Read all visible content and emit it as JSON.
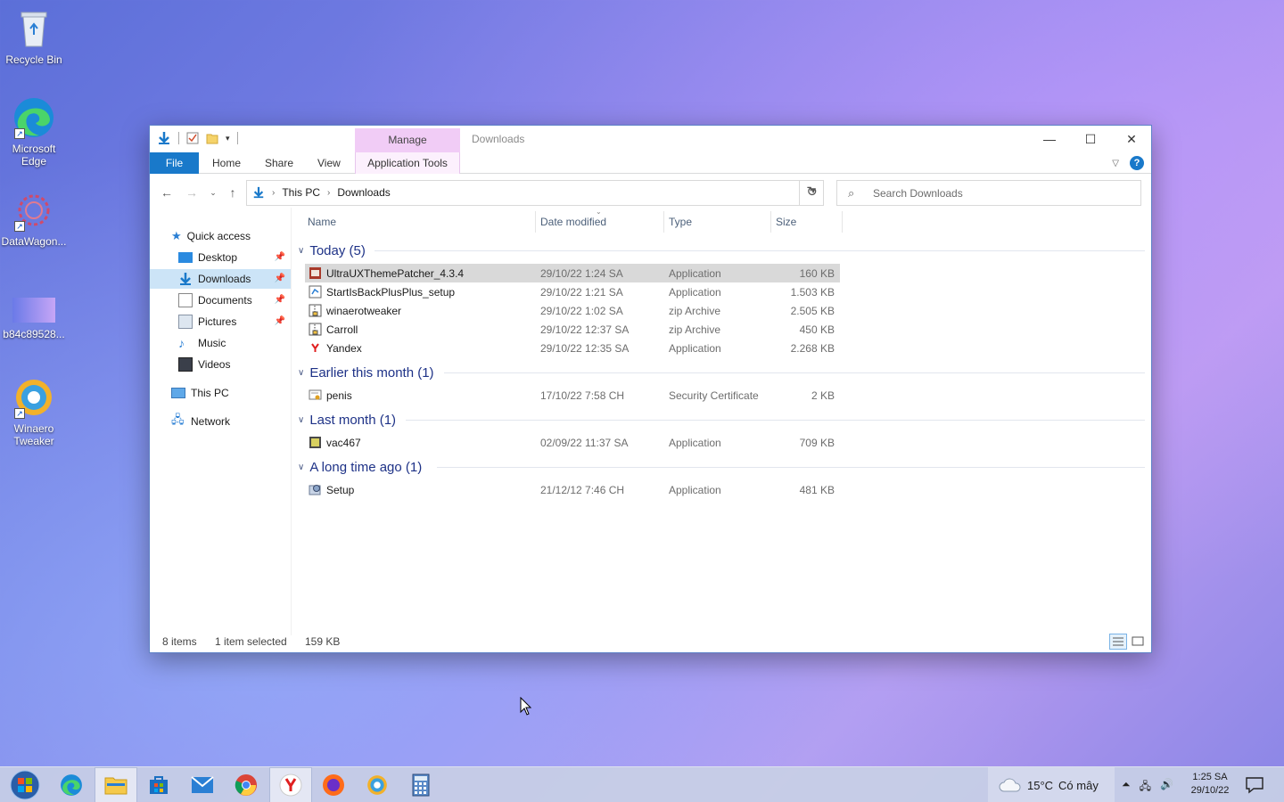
{
  "desktop": {
    "icons": [
      {
        "label": "Recycle Bin"
      },
      {
        "label": "Microsoft Edge"
      },
      {
        "label": "DataWagon..."
      },
      {
        "label": "b84c89528..."
      },
      {
        "label": "Winaero Tweaker"
      }
    ]
  },
  "window": {
    "title": "Downloads",
    "manage_tab": "Manage",
    "ribbon_tabs": [
      "File",
      "Home",
      "Share",
      "View",
      "Application Tools"
    ],
    "address": {
      "crumbs": [
        "This PC",
        "Downloads"
      ]
    },
    "search_placeholder": "Search Downloads",
    "nav": {
      "quick_access": "Quick access",
      "items": [
        "Desktop",
        "Downloads",
        "Documents",
        "Pictures",
        "Music",
        "Videos"
      ],
      "this_pc": "This PC",
      "network": "Network"
    },
    "columns": [
      "Name",
      "Date modified",
      "Type",
      "Size"
    ],
    "groups": [
      {
        "label": "Today (5)",
        "files": [
          {
            "name": "UltraUXThemePatcher_4.3.4",
            "date": "29/10/22 1:24 SA",
            "type": "Application",
            "size": "160 KB",
            "selected": true
          },
          {
            "name": "StartIsBackPlusPlus_setup",
            "date": "29/10/22 1:21 SA",
            "type": "Application",
            "size": "1.503 KB"
          },
          {
            "name": "winaerotweaker",
            "date": "29/10/22 1:02 SA",
            "type": "zip Archive",
            "size": "2.505 KB"
          },
          {
            "name": "Carroll",
            "date": "29/10/22 12:37 SA",
            "type": "zip Archive",
            "size": "450 KB"
          },
          {
            "name": "Yandex",
            "date": "29/10/22 12:35 SA",
            "type": "Application",
            "size": "2.268 KB"
          }
        ]
      },
      {
        "label": "Earlier this month (1)",
        "files": [
          {
            "name": "penis",
            "date": "17/10/22 7:58 CH",
            "type": "Security Certificate",
            "size": "2 KB"
          }
        ]
      },
      {
        "label": "Last month (1)",
        "files": [
          {
            "name": "vac467",
            "date": "02/09/22 11:37 SA",
            "type": "Application",
            "size": "709 KB"
          }
        ]
      },
      {
        "label": "A long time ago (1)",
        "files": [
          {
            "name": "Setup",
            "date": "21/12/12 7:46 CH",
            "type": "Application",
            "size": "481 KB"
          }
        ]
      }
    ],
    "status": {
      "items": "8 items",
      "selected": "1 item selected",
      "size": "159 KB"
    }
  },
  "taskbar": {
    "weather": {
      "temp": "15°C",
      "desc": "Có mây"
    },
    "clock": {
      "time": "1:25 SA",
      "date": "29/10/22"
    }
  },
  "colors": {
    "accent": "#1979ca",
    "manage": "#f1ccf6",
    "group_text": "#1e3287"
  }
}
